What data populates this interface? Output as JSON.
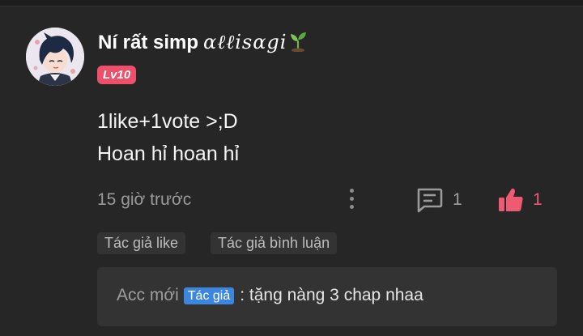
{
  "author": {
    "name": "Ní rất simp",
    "decoration": "ɑℓℓisɑgi",
    "level": "Lv10"
  },
  "comment": {
    "lines": [
      "1like+1vote >;D",
      "Hoan hỉ hoan hỉ"
    ],
    "time": "15 giờ trước"
  },
  "actions": {
    "reply_count": "1",
    "like_count": "1"
  },
  "tags": [
    "Tác giả like",
    "Tác giả bình luận"
  ],
  "reply": {
    "user": "Acc mới",
    "badge": "Tác giả",
    "text": ": tặng nàng 3 chap nhaa"
  },
  "colors": {
    "background": "#262626",
    "level_badge": "#ef4f6a",
    "like": "#ef5a73",
    "author_badge": "#3d86e0"
  },
  "icons": {
    "more": "vertical-dots-icon",
    "reply": "chat-bubble-icon",
    "like": "thumbs-up-icon",
    "decoration": "sprout-icon"
  }
}
